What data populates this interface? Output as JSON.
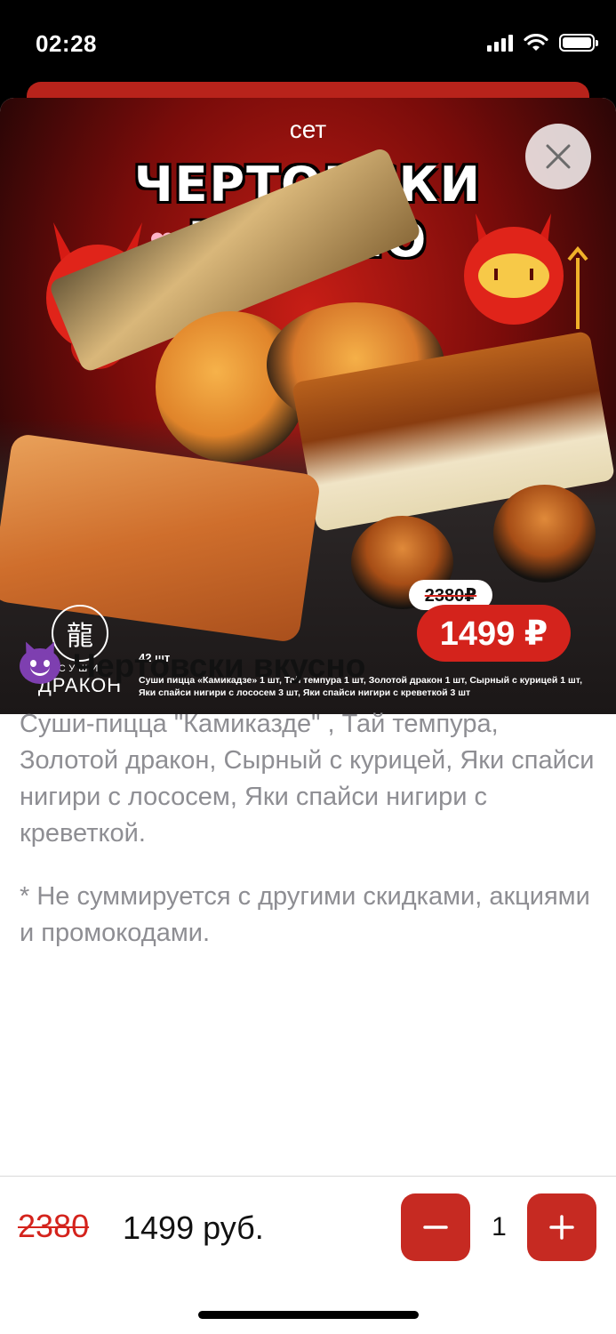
{
  "status_bar": {
    "time": "02:28"
  },
  "banner": {
    "subtitle": "сет",
    "title_line1": "ЧЕРТОВСКИ",
    "title_line2": "ВКУСНО",
    "old_price": "2380₽",
    "new_price": "1499 ₽",
    "pieces": "42 шт",
    "composition": "Суши пицца «Камикадзе» 1 шт, Тай темпура 1 шт, Золотой дракон 1 шт, Сырный с курицей 1 шт, Яки спайси нигири с лососем 3 шт, Яки спайси нигири с креветкой 3 шт",
    "logo_top": "СУШИ",
    "logo_name": "ДРАКОН"
  },
  "product": {
    "title": "Чертовски вкусно",
    "description": "Суши-пицца \"Камиказде\" , Тай темпура, Золотой дракон, Сырный с курицей, Яки спайси нигири с лососем, Яки спайси нигири с креветкой.",
    "disclaimer": "* Не суммируется с другими скидками, акциями и промокодами."
  },
  "purchase": {
    "old_price": "2380",
    "new_price": "1499 руб.",
    "quantity": "1"
  },
  "icons": {
    "close": "close-icon",
    "minus": "minus-icon",
    "plus": "plus-icon",
    "emoji": "smiling-devil-emoji"
  },
  "colors": {
    "accent": "#c62a22",
    "old_price": "#d4231c",
    "secondary_text": "#8e8e93"
  }
}
